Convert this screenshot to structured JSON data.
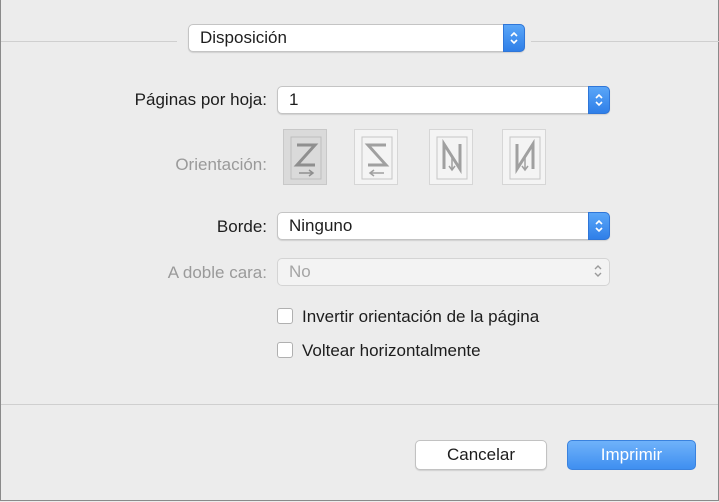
{
  "header": {
    "section_popup": {
      "value": "Disposición",
      "icon": "stepper-arrows-icon"
    }
  },
  "layout": {
    "pages_per_sheet": {
      "label": "Páginas por hoja:",
      "value": "1"
    },
    "orientation": {
      "label": "Orientación:",
      "options": [
        {
          "name": "z-order",
          "selected": true
        },
        {
          "name": "reverse-z-order",
          "selected": false
        },
        {
          "name": "n-order",
          "selected": false
        },
        {
          "name": "reverse-n-order",
          "selected": false
        }
      ]
    },
    "border": {
      "label": "Borde:",
      "value": "Ninguno"
    },
    "two_sided": {
      "label": "A doble cara:",
      "value": "No"
    },
    "reverse_orientation": {
      "label": "Invertir orientación de la página",
      "checked": false
    },
    "flip_horizontally": {
      "label": "Voltear horizontalmente",
      "checked": false
    }
  },
  "footer": {
    "cancel_label": "Cancelar",
    "print_label": "Imprimir"
  },
  "colors": {
    "accent": "#3f8ff0",
    "disabled_text": "#a5a5a5",
    "background": "#ececec"
  }
}
